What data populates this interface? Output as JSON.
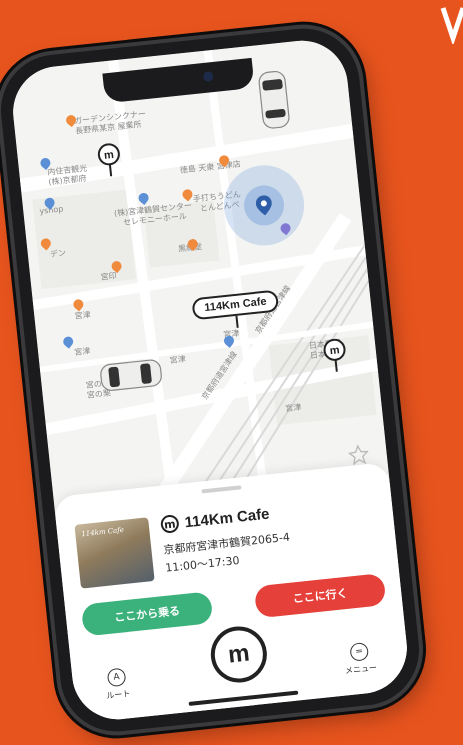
{
  "map": {
    "labels": [
      "ガーデンシンクナー",
      "長野県某京 屋業所",
      "内住吉観光",
      "(株)京都府",
      "yshop",
      "デン",
      "(株)宮津鶴賀センター",
      "セレモニーホール",
      "徳島 天衆 宮津店",
      "手打ちうどん",
      "とんどんべ",
      "黒縁堂",
      "宮印",
      "宮津",
      "宮津",
      "宮津",
      "宮の栗",
      "宮の栗",
      "京都府道宮津線",
      "京都府道宮津線",
      "日本郵便",
      "日本郵便",
      "宮津",
      "宮津"
    ]
  },
  "cafe_tag": "114Km Cafe",
  "sheet": {
    "photo_sign": "114km Cafe",
    "logo_letter": "m",
    "name": "114Km Cafe",
    "address": "京都府宮津市鶴賀2065-4",
    "hours": "11:00〜17:30",
    "ride_button": "ここから乗る",
    "go_button": "ここに行く"
  },
  "tabbar": {
    "route_icon_letter": "A",
    "route_label": "ルート",
    "center_logo": "m",
    "menu_icon": "=",
    "menu_label": "メニュー"
  },
  "colors": {
    "background": "#e8541e",
    "green": "#3bb27c",
    "red": "#e5403a",
    "location_blue": "#5b8fd6"
  }
}
